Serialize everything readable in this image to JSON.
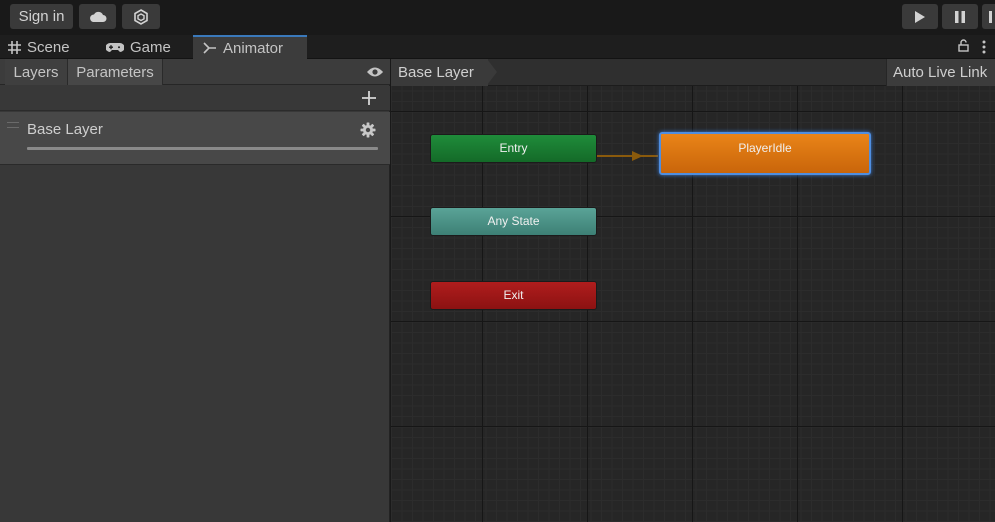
{
  "toolbar": {
    "sign_in_label": "Sign in",
    "cloud_icon": "cloud-icon",
    "collab_icon": "hexagon-icon",
    "play_icon": "play-icon",
    "pause_icon": "pause-icon"
  },
  "tabs": [
    {
      "label": "Scene",
      "icon": "grid-icon"
    },
    {
      "label": "Game",
      "icon": "gamepad-icon"
    },
    {
      "label": "Animator",
      "icon": "animator-icon"
    }
  ],
  "left_panel": {
    "tabs": [
      "Layers",
      "Parameters"
    ],
    "layer_name": "Base Layer"
  },
  "graph": {
    "breadcrumb": "Base Layer",
    "auto_live_link": "Auto Live Link",
    "nodes": {
      "entry": "Entry",
      "any_state": "Any State",
      "exit": "Exit",
      "player_idle": "PlayerIdle"
    }
  },
  "colors": {
    "accent": "#3a79bb",
    "entry": "#1f8c3a",
    "any_state": "#5aa397",
    "exit": "#b01d1d",
    "state_default": "#e98418",
    "transition": "#8a5a0c"
  }
}
